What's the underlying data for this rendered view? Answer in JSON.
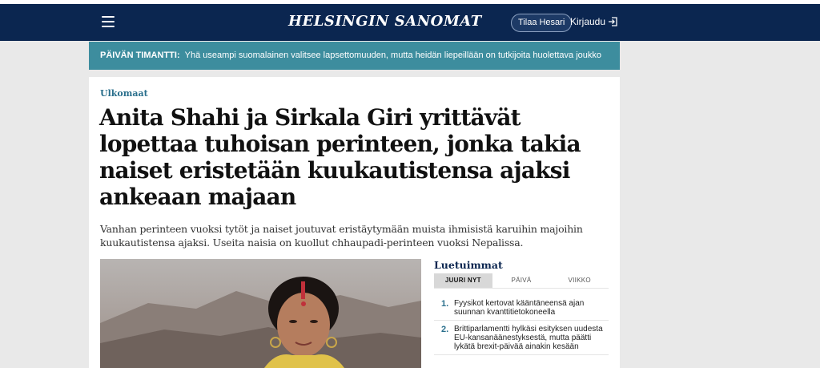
{
  "header": {
    "logo": "HELSINGIN SANOMAT",
    "subscribe_label": "Tilaa Hesari",
    "login_label": "Kirjaudu"
  },
  "promo": {
    "label": "PÄIVÄN TIMANTTI:",
    "text": "Yhä useampi suomalainen valitsee lapsettomuuden, mutta heidän liepeillään on tutkijoita huolettava joukko"
  },
  "article": {
    "category": "Ulkomaat",
    "headline": "Anita Shahi ja Sirkala Giri yrittävät lopettaa tuhoisan perinteen, jonka takia naiset eristetään kuukautistensa ajaksi ankeaan majaan",
    "lead": "Vanhan perinteen vuoksi tytöt ja naiset joutuvat eristäytymään muista ihmisistä karuihin majoihin kuukautistensa ajaksi. Useita naisia on kuollut chhaupadi-perinteen vuoksi Nepalissa."
  },
  "popular": {
    "title": "Luetuimmat",
    "tabs": [
      "JUURI NYT",
      "PÄIVÄ",
      "VIIKKO"
    ],
    "active_tab": 0,
    "items": [
      {
        "num": "1.",
        "text": "Fyysikot kertovat kääntäneensä ajan suunnan kvanttitietokoneella"
      },
      {
        "num": "2.",
        "text": "Brittiparlamentti hylkäsi esityksen uudesta EU-kansanäänestyksestä, mutta päätti lykätä brexit-päivää ainakin kesään"
      }
    ]
  },
  "colors": {
    "header_bg": "#0b2650",
    "promo_bg": "#3d8d9e",
    "accent": "#2a6f8c"
  }
}
